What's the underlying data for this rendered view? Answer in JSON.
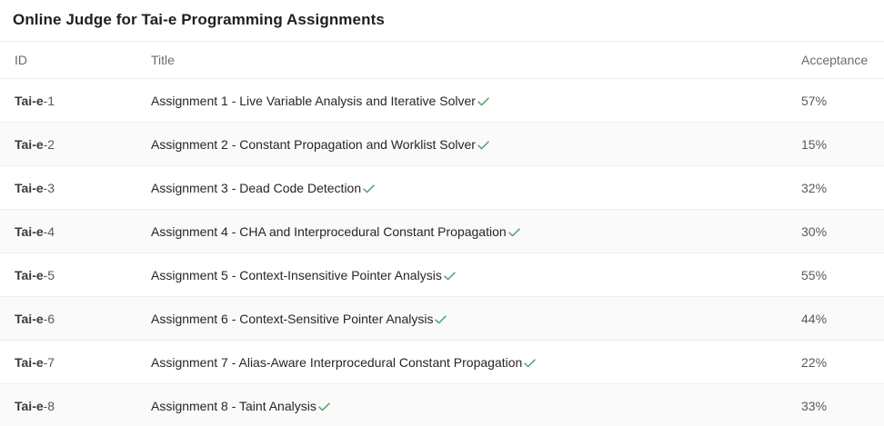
{
  "header": {
    "title": "Online Judge for Tai-e Programming Assignments"
  },
  "table": {
    "columns": {
      "id": "ID",
      "title": "Title",
      "acceptance": "Acceptance"
    },
    "rows": [
      {
        "id_prefix": "Tai-e",
        "id_suffix": "-1",
        "title": "Assignment 1 - Live Variable Analysis and Iterative Solver",
        "solved": true,
        "acceptance": "57%"
      },
      {
        "id_prefix": "Tai-e",
        "id_suffix": "-2",
        "title": "Assignment 2 - Constant Propagation and Worklist Solver",
        "solved": true,
        "acceptance": "15%"
      },
      {
        "id_prefix": "Tai-e",
        "id_suffix": "-3",
        "title": "Assignment 3 - Dead Code Detection",
        "solved": true,
        "acceptance": "32%"
      },
      {
        "id_prefix": "Tai-e",
        "id_suffix": "-4",
        "title": "Assignment 4 - CHA and Interprocedural Constant Propagation",
        "solved": true,
        "acceptance": "30%"
      },
      {
        "id_prefix": "Tai-e",
        "id_suffix": "-5",
        "title": "Assignment 5 - Context-Insensitive Pointer Analysis",
        "solved": true,
        "acceptance": "55%"
      },
      {
        "id_prefix": "Tai-e",
        "id_suffix": "-6",
        "title": "Assignment 6 - Context-Sensitive Pointer Analysis",
        "solved": true,
        "acceptance": "44%"
      },
      {
        "id_prefix": "Tai-e",
        "id_suffix": "-7",
        "title": "Assignment 7 - Alias-Aware Interprocedural Constant Propagation",
        "solved": true,
        "acceptance": "22%"
      },
      {
        "id_prefix": "Tai-e",
        "id_suffix": "-8",
        "title": "Assignment 8 - Taint Analysis",
        "solved": true,
        "acceptance": "33%"
      }
    ]
  },
  "colors": {
    "check": "#52a36b",
    "stripe": "#fafafa",
    "border": "#efefef"
  },
  "icons": {
    "solved": "check-icon"
  }
}
